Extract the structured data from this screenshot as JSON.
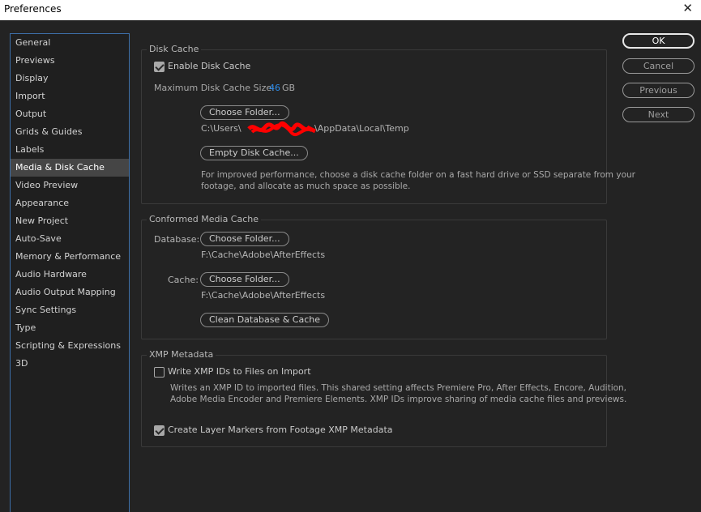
{
  "window": {
    "title": "Preferences",
    "close_glyph": "✕"
  },
  "sidebar": {
    "items": [
      {
        "label": "General"
      },
      {
        "label": "Previews"
      },
      {
        "label": "Display"
      },
      {
        "label": "Import"
      },
      {
        "label": "Output"
      },
      {
        "label": "Grids & Guides"
      },
      {
        "label": "Labels"
      },
      {
        "label": "Media & Disk Cache"
      },
      {
        "label": "Video Preview"
      },
      {
        "label": "Appearance"
      },
      {
        "label": "New Project"
      },
      {
        "label": "Auto-Save"
      },
      {
        "label": "Memory & Performance"
      },
      {
        "label": "Audio Hardware"
      },
      {
        "label": "Audio Output Mapping"
      },
      {
        "label": "Sync Settings"
      },
      {
        "label": "Type"
      },
      {
        "label": "Scripting & Expressions"
      },
      {
        "label": "3D"
      }
    ],
    "selected": "Media & Disk Cache"
  },
  "disk_cache": {
    "title": "Disk Cache",
    "enable_label": "Enable Disk Cache",
    "enable_checked": true,
    "max_size_label": "Maximum Disk Cache Size:",
    "max_size_value": "46",
    "max_size_unit": "GB",
    "choose_folder": "Choose Folder...",
    "path_prefix": "C:\\Users\\",
    "path_suffix": "\\AppData\\Local\\Temp",
    "empty_button": "Empty Disk Cache...",
    "description_line1": "For improved performance, choose a disk cache folder on a fast hard drive or SSD separate from your",
    "description_line2": "footage, and allocate as much space as possible."
  },
  "conformed_cache": {
    "title": "Conformed Media Cache",
    "database_label": "Database:",
    "database_button": "Choose Folder...",
    "database_path": "F:\\Cache\\Adobe\\AfterEffects",
    "cache_label": "Cache:",
    "cache_button": "Choose Folder...",
    "cache_path": "F:\\Cache\\Adobe\\AfterEffects",
    "clean_button": "Clean Database & Cache"
  },
  "xmp": {
    "title": "XMP Metadata",
    "write_label": "Write XMP IDs to Files on Import",
    "write_checked": false,
    "write_desc_line1": "Writes an XMP ID to imported files. This shared setting affects Premiere Pro, After Effects, Encore, Audition,",
    "write_desc_line2": "Adobe Media Encoder and Premiere Elements. XMP IDs improve sharing of media cache files and previews.",
    "markers_label": "Create Layer Markers from Footage XMP Metadata",
    "markers_checked": true
  },
  "buttons": {
    "ok": "OK",
    "cancel": "Cancel",
    "previous": "Previous",
    "next": "Next"
  },
  "colors": {
    "background": "#232323",
    "accent_blue": "#2d8ceb",
    "sidebar_border": "#3d6fa8",
    "redaction": "#ff0000"
  }
}
